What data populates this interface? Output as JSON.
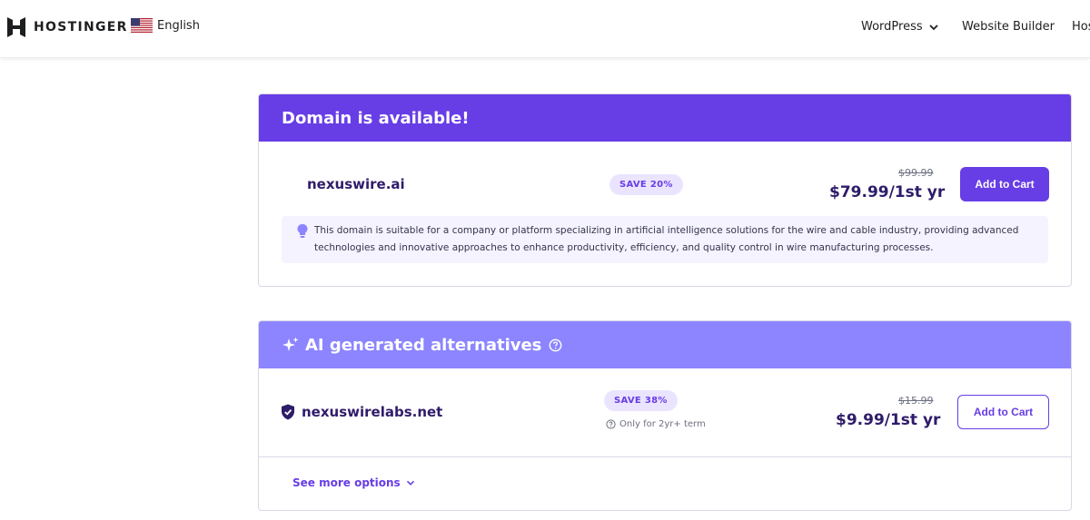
{
  "header": {
    "logo_text": "HOSTINGER",
    "language": "English",
    "nav": [
      {
        "label": "WordPress"
      },
      {
        "label": "Website Builder"
      },
      {
        "label": "Hos"
      }
    ]
  },
  "available": {
    "title": "Domain is available!",
    "domain": "nexuswire.ai",
    "save_badge": "SAVE 20%",
    "old_price": "$99.99",
    "price": "$79.99/1st yr",
    "button": "Add to Cart",
    "description": "This domain is suitable for a company or platform specializing in artificial intelligence solutions for the wire and cable industry, providing advanced technologies and innovative approaches to enhance productivity, efficiency, and quality control in wire manufacturing processes."
  },
  "alternatives": {
    "title": "AI generated alternatives",
    "items": [
      {
        "domain": "nexuswirelabs.net",
        "save_badge": "SAVE 38%",
        "term_note": "Only for 2yr+ term",
        "old_price": "$15.99",
        "price": "$9.99/1st yr",
        "button": "Add to Cart"
      }
    ],
    "see_more": "See more options"
  },
  "colors": {
    "brand": "#673de6",
    "ai_header": "#8c85ff",
    "text_dark": "#2f1c6a",
    "badge_bg": "#ebe4ff"
  },
  "icons": [
    "hostinger-logo-icon",
    "us-flag-icon",
    "chevron-down-icon",
    "sparkle-icon",
    "help-circle-icon",
    "lightbulb-icon",
    "shield-check-icon"
  ]
}
